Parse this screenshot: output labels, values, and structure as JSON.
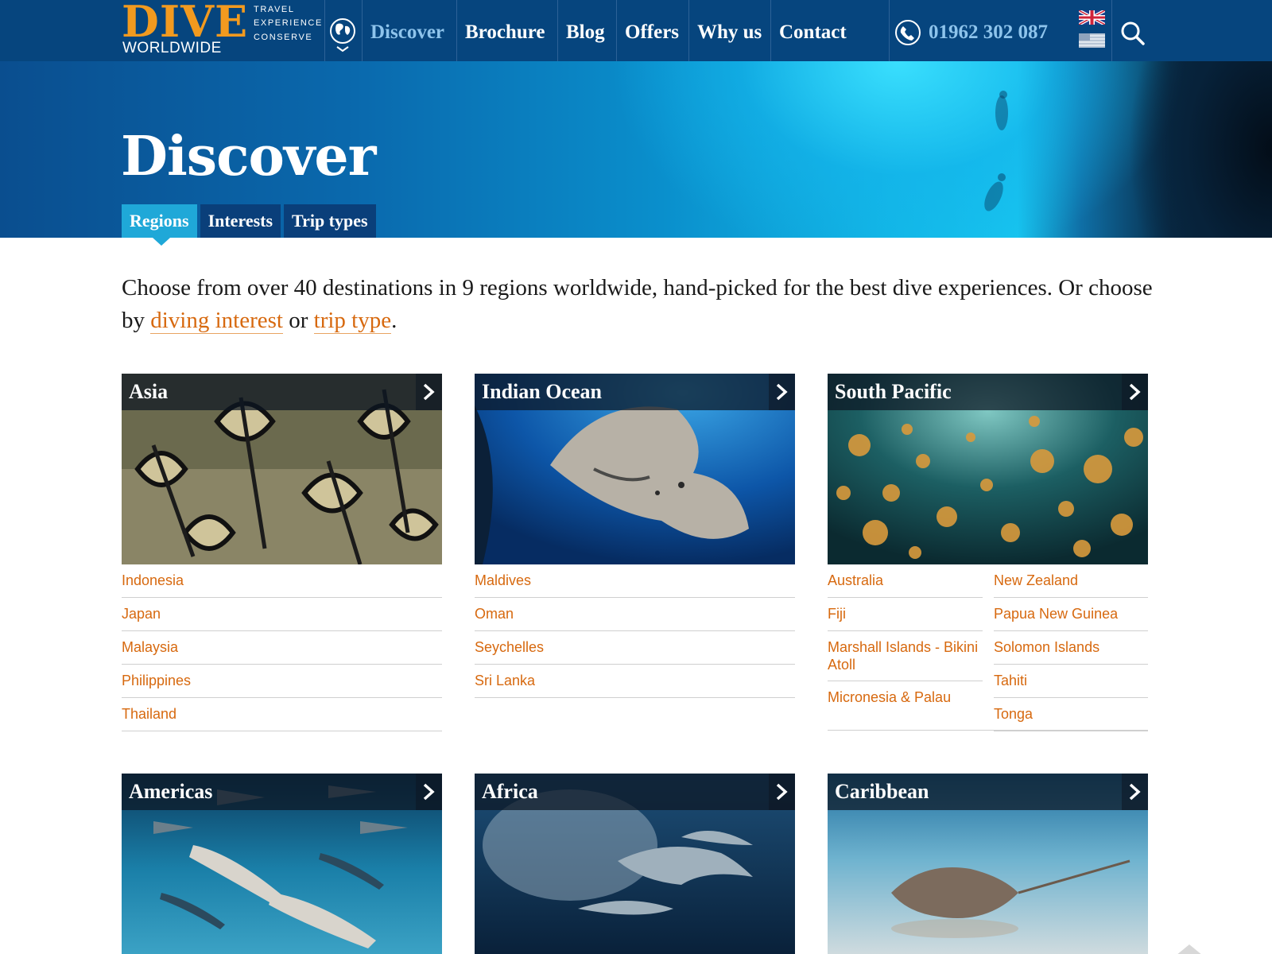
{
  "header": {
    "logo": {
      "word": "DIVE",
      "sub": "WORLDWIDE",
      "tagline": [
        "TRAVEL",
        "EXPERIENCE",
        "CONSERVE"
      ]
    },
    "nav": [
      "Discover",
      "Brochure",
      "Blog",
      "Offers",
      "Why us",
      "Contact"
    ],
    "active_nav": "Discover",
    "phone": "01962 302 087",
    "icons": [
      "globe-icon",
      "phone-icon",
      "uk-flag-icon",
      "us-flag-icon",
      "search-icon"
    ]
  },
  "hero": {
    "title": "Discover",
    "tabs": [
      "Regions",
      "Interests",
      "Trip types"
    ],
    "active_tab": "Regions"
  },
  "intro": {
    "text_before": "Choose from over 40 destinations in 9 regions worldwide, hand-picked for the best dive experiences. Or choose by ",
    "link1": "diving interest",
    "text_mid": " or ",
    "link2": "trip type",
    "text_after": "."
  },
  "regions": [
    {
      "title": "Asia",
      "links": [
        "Indonesia",
        "Japan",
        "Malaysia",
        "Philippines",
        "Thailand"
      ]
    },
    {
      "title": "Indian Ocean",
      "links": [
        "Maldives",
        "Oman",
        "Seychelles",
        "Sri Lanka"
      ]
    },
    {
      "title": "South Pacific",
      "links_col1": [
        "Australia",
        "Fiji",
        "Marshall Islands - Bikini Atoll",
        "Micronesia & Palau"
      ],
      "links_col2": [
        "New Zealand",
        "Papua New Guinea",
        "Solomon Islands",
        "Tahiti",
        "Tonga"
      ]
    },
    {
      "title": "Americas"
    },
    {
      "title": "Africa"
    },
    {
      "title": "Caribbean"
    }
  ],
  "colors": {
    "header": "#06457e",
    "accent_link": "#d7690f",
    "logo": "#f29a1f",
    "tab_active": "#1fa8d8"
  }
}
